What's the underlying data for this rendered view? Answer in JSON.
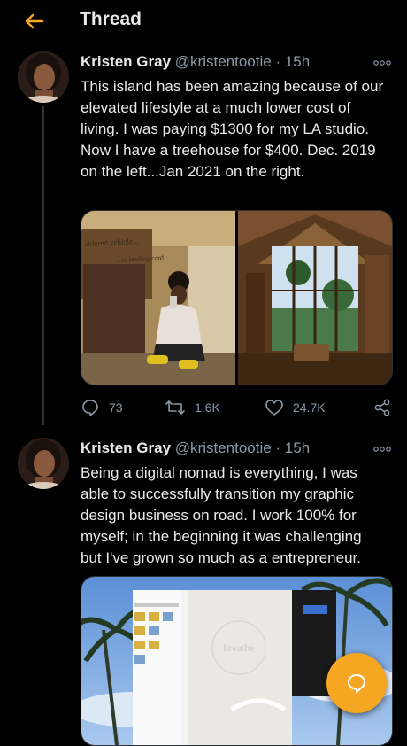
{
  "header": {
    "title": "Thread",
    "back_icon": "arrow-left-icon",
    "accent": "#f5a623"
  },
  "tweets": [
    {
      "name": "Kristen Gray",
      "handle": "@kristentootie",
      "separator": "·",
      "time": "15h",
      "text": "This island has been amazing because of our elevated lifestyle at a much lower cost of living. I was paying $1300 for my LA studio. Now I have a treehouse for $400. Dec. 2019 on the left...Jan 2021 on the right.",
      "media_left_overlay": "sidered vehicle... ...te leading card",
      "replies": "73",
      "retweets": "1.6K",
      "likes": "24.7K"
    },
    {
      "name": "Kristen Gray",
      "handle": "@kristentootie",
      "separator": "·",
      "time": "15h",
      "text": "Being a digital nomad is everything, I was able to successfully transition my graphic design business on road. I work 100% for myself; in the beginning it was challenging but I've grown so much as a entrepreneur.",
      "media_watermark": "breathe"
    }
  ],
  "fab": {
    "icon": "compose-reply-icon",
    "color": "#f5a623"
  }
}
